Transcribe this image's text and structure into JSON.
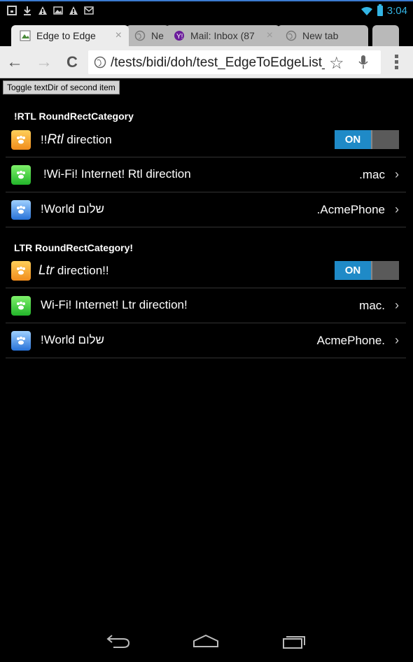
{
  "status_bar": {
    "time": "3:04",
    "accent_color": "#33b5e5",
    "left_icons": [
      "notification-icon",
      "download-icon",
      "warning-icon",
      "image-icon",
      "warning-icon",
      "gmail-icon"
    ]
  },
  "tabs": [
    {
      "title": "Edge to Edge",
      "active": true,
      "close": "×"
    },
    {
      "title": "Ne",
      "active": false
    },
    {
      "title": "Mail: Inbox (87",
      "active": false,
      "close": "×"
    },
    {
      "title": "New tab",
      "active": false
    }
  ],
  "toolbar": {
    "url": "/tests/bidi/doh/test_EdgeToEdgeList_",
    "back": "←",
    "forward": "→",
    "reload": "C",
    "star": "☆"
  },
  "page": {
    "toggle_button": "Toggle textDir of second item",
    "rtl_category": "!RTL RoundRectCategory",
    "ltr_category": "LTR RoundRectCategory!",
    "rtl_items": [
      {
        "label_prefix": "!!",
        "label_italic": "Rtl",
        "label_suffix": " direction",
        "right": "",
        "switch": "ON",
        "icon": "orange"
      },
      {
        "label": "!Wi-Fi! Internet! Rtl direction",
        "right": ".mac",
        "chevron": "›",
        "icon": "green"
      },
      {
        "label": "!World שלום",
        "right": ".AcmePhone",
        "chevron": "›",
        "icon": "blue"
      }
    ],
    "ltr_items": [
      {
        "label_italic": "Ltr",
        "label_suffix": " direction!!",
        "switch": "ON",
        "icon": "orange"
      },
      {
        "label": "Wi-Fi! Internet! Ltr direction!",
        "right": "mac.",
        "chevron": "›",
        "icon": "green"
      },
      {
        "label": "שלום World!",
        "right": "AcmePhone.",
        "chevron": "›",
        "icon": "blue"
      }
    ],
    "switch_on_color": "#1f8ac7"
  },
  "nav": {
    "back_icon": "back-icon",
    "home_icon": "home-icon",
    "recents_icon": "recents-icon"
  }
}
